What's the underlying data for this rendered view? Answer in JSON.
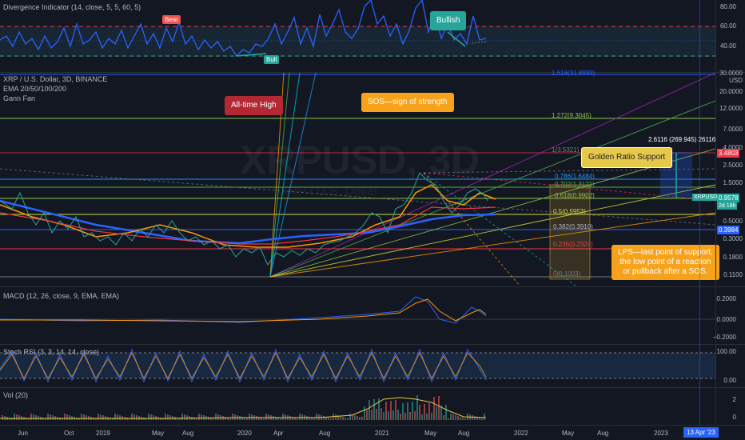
{
  "divergence": {
    "title": "Divergence Indicator (14, close, 5, 5, 60, 5)",
    "ticks": [
      "80.00",
      "60.00",
      "40.00"
    ],
    "bear_label": "Bear",
    "bull_label": "Bull",
    "bullish_label": "Bullish"
  },
  "main": {
    "symbol_line": "XRP / U.S. Dollar, 3D, BINANCE",
    "ema_line": "EMA 20/50/100/200",
    "gann_line": "Gann Fan",
    "watermark": "XRPUSD, 3D",
    "watermark_sub": "XRP / U.S. Dollar",
    "price_ticks": [
      "30.0000",
      "USD",
      "20.0000",
      "12.0000",
      "7.0000",
      "4.0000",
      "2.5000",
      "1.5000",
      "0.5000",
      "0.3000",
      "0.1800",
      "0.1100"
    ],
    "fib_levels": [
      {
        "label": "1.618(31.8999)",
        "color": "#2962ff"
      },
      {
        "label": "1.272(9.3045)",
        "color": "#8bc34a"
      },
      {
        "label": "1(3.5321)",
        "color": "#787b86"
      },
      {
        "label": "0.786(1.6484)",
        "color": "#2196f3"
      },
      {
        "label": "0.702(1.3121)",
        "color": "#4caf50"
      },
      {
        "label": "0.618(0.9902)",
        "color": "#8bc34a"
      },
      {
        "label": "0.5(0.5953)",
        "color": "#cddc39"
      },
      {
        "label": "0.382(0.3910)",
        "color": "#b2b5be"
      },
      {
        "label": "0.236(0.2324)",
        "color": "#f23645"
      },
      {
        "label": "0(0.1003)",
        "color": "#787b86"
      }
    ],
    "measure_label": "2.6116 (269.945) 26116",
    "price_tag_red": "3.4803",
    "price_tag_green": "0.9578",
    "symbol_tag": "XRPUSD",
    "countdown_tag": "2d 18h",
    "blue_tag": "0.3984",
    "callouts": {
      "ath": "All-time High",
      "sos": "SOS—sign of strength",
      "golden": "Golden Ratio Support",
      "lps_1": "LPS—last point of support,",
      "lps_2": "the low point of a reaction",
      "lps_3": "or pullback after a SOS."
    }
  },
  "macd": {
    "title": "MACD (12, 26, close, 9, EMA, EMA)",
    "ticks": [
      "0.2000",
      "0.0000",
      "−0.2000"
    ]
  },
  "stoch": {
    "title": "Stoch RSI (3, 3, 14, 14, close)",
    "ticks": [
      "100.00",
      "0.00"
    ]
  },
  "vol": {
    "title": "Vol (20)",
    "ticks": [
      "2",
      "0"
    ]
  },
  "time_axis": {
    "labels": [
      "Jun",
      "Oct",
      "2019",
      "May",
      "Aug",
      "2020",
      "Apr",
      "Aug",
      "2021",
      "May",
      "Aug",
      "2022",
      "May",
      "Aug",
      "2023"
    ],
    "current": "13 Apr '23"
  },
  "colors": {
    "bg": "#131722",
    "bull": "#26a69a",
    "bear": "#ef5350",
    "callout_orange": "#f7a21b",
    "callout_red": "#b22833",
    "callout_yellow": "#e6c84a"
  }
}
